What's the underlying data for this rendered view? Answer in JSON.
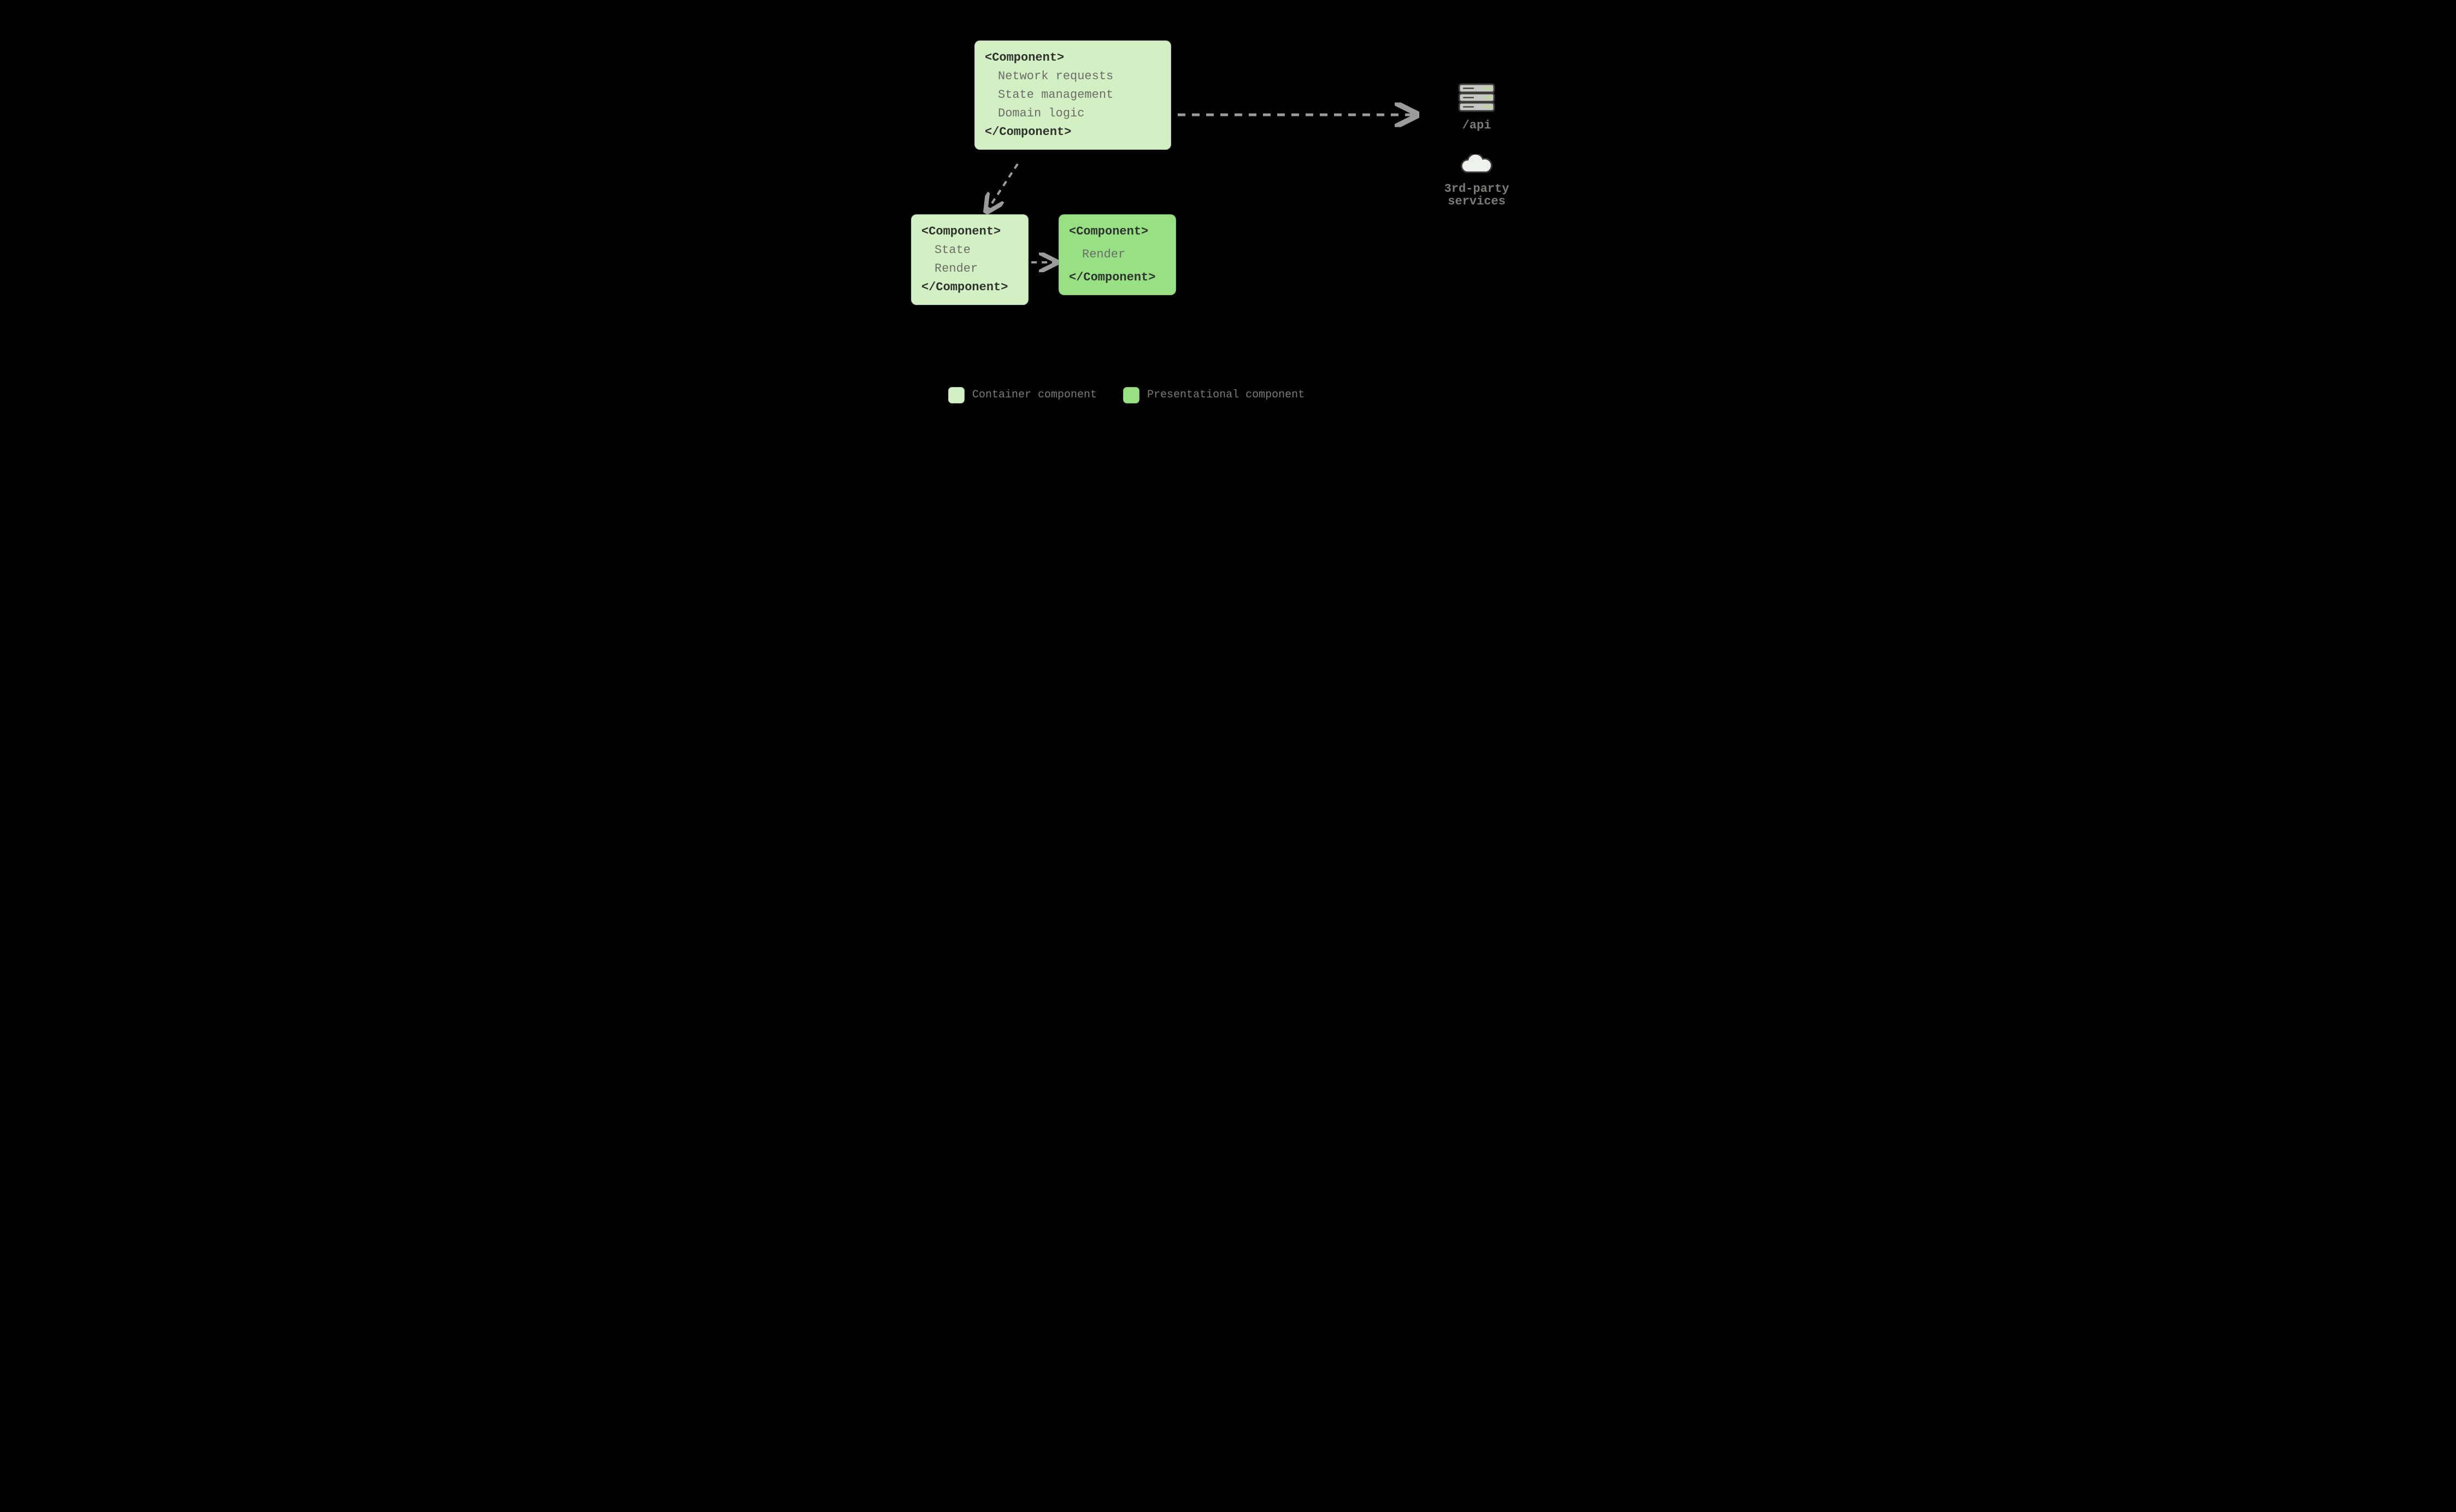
{
  "boxes": {
    "top": {
      "open": "<Component>",
      "lines": [
        "Network requests",
        "State management",
        "Domain logic"
      ],
      "close": "</Component>"
    },
    "bottomLeft": {
      "open": "<Component>",
      "lines": [
        "State",
        "Render"
      ],
      "close": "</Component>"
    },
    "bottomRight": {
      "open": "<Component>",
      "lines": [
        "Render"
      ],
      "close": "</Component>"
    }
  },
  "right": {
    "api": "/api",
    "services_l1": "3rd-party",
    "services_l2": "services"
  },
  "legend": {
    "container": "Container component",
    "presentational": "Presentational component"
  },
  "colors": {
    "container": "#d3f0c4",
    "presentational": "#97e084",
    "arrow": "#9c9c9c"
  }
}
